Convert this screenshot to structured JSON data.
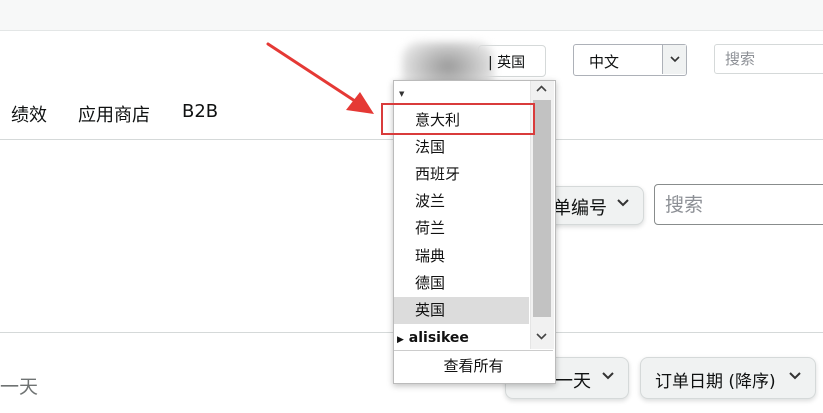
{
  "header": {
    "marketplace_label": "| 英国",
    "language": {
      "selected": "中文"
    },
    "search_placeholder": "搜索"
  },
  "nav": {
    "items": [
      "绩效",
      "应用商店",
      "B2B"
    ]
  },
  "filter": {
    "type_label": "单编号",
    "search_placeholder": "搜索"
  },
  "bottom": {
    "left_text": "一天",
    "range_label": "一天",
    "sort_label": "订单日期 (降序)"
  },
  "dropdown": {
    "items": [
      "意大利",
      "法国",
      "西班牙",
      "波兰",
      "荷兰",
      "瑞典",
      "德国",
      "英国"
    ],
    "selected": "英国",
    "group_label": "alisikee",
    "view_all": "查看所有"
  },
  "annotation": {
    "color": "#d93b3b"
  },
  "icons": {
    "chevron": "chevron-down-icon",
    "arrow": "red-arrow-icon"
  }
}
